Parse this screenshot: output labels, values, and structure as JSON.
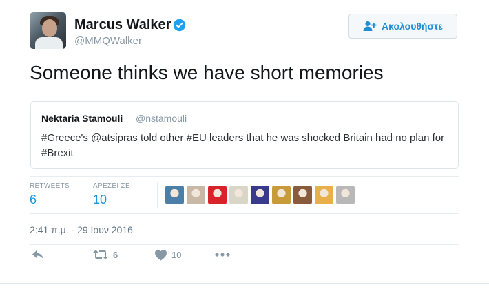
{
  "author": {
    "name": "Marcus Walker",
    "handle": "@MMQWalker",
    "verified_icon": "verified-badge-icon"
  },
  "follow_button": {
    "label": "Ακολουθήστε",
    "icon": "add-user-icon"
  },
  "tweet": {
    "text": "Someone thinks we have short memories"
  },
  "quoted_tweet": {
    "name": "Nektaria Stamouli",
    "handle": "@nstamouli",
    "text": "#Greece's @atsipras told other #EU leaders that he was shocked Britain had no plan for #Brexit"
  },
  "stats": {
    "retweets_label": "RETWEETS",
    "retweets_count": "6",
    "likes_label": "ΑΡΕΣΕΙ ΣΕ",
    "likes_count": "10"
  },
  "liker_avatars": [
    {
      "name": "liker-avatar-1",
      "color": "#4b7fa8"
    },
    {
      "name": "liker-avatar-2",
      "color": "#c9b8a6"
    },
    {
      "name": "liker-avatar-3",
      "color": "#d8232a"
    },
    {
      "name": "liker-avatar-4",
      "color": "#d9d6c8"
    },
    {
      "name": "liker-avatar-5",
      "color": "#3a3a8c"
    },
    {
      "name": "liker-avatar-6",
      "color": "#c79a3a"
    },
    {
      "name": "liker-avatar-7",
      "color": "#8a5a3c"
    },
    {
      "name": "liker-avatar-8",
      "color": "#e8b04a"
    },
    {
      "name": "liker-avatar-9",
      "color": "#b8b8b8"
    }
  ],
  "timestamp": "2:41 π.μ. - 29 Ιουν 2016",
  "actions": {
    "reply_icon": "reply-icon",
    "retweet_icon": "retweet-icon",
    "retweet_count": "6",
    "like_icon": "heart-icon",
    "like_count": "10",
    "more_icon": "more-dots-icon"
  },
  "colors": {
    "accent": "#1b95e0",
    "muted": "#8899a6",
    "text": "#14171a",
    "border": "#e6ecf0"
  }
}
